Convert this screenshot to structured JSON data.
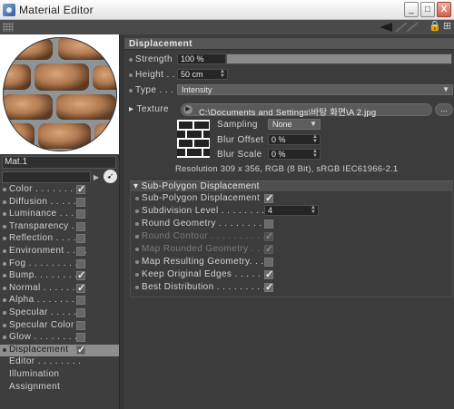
{
  "window": {
    "title": "Material Editor",
    "minimize_label": "_",
    "maximize_label": "□",
    "close_label": "X"
  },
  "left": {
    "material_name": "Mat.1",
    "channels": [
      {
        "label": "Color . . . . . . . . .",
        "checked": true
      },
      {
        "label": "Diffusion . . . . . .",
        "checked": false
      },
      {
        "label": "Luminance . . . . .",
        "checked": false
      },
      {
        "label": "Transparency . . .",
        "checked": false
      },
      {
        "label": "Reflection . . . . .",
        "checked": false
      },
      {
        "label": "Environment . . . .",
        "checked": false
      },
      {
        "label": "Fog . . . . . . . . . .",
        "checked": false
      },
      {
        "label": "Bump. . . . . . . . .",
        "checked": true
      },
      {
        "label": "Normal . . . . . . .",
        "checked": true
      },
      {
        "label": "Alpha . . . . . . . .",
        "checked": false
      },
      {
        "label": "Specular . . . . . .",
        "checked": false
      },
      {
        "label": "Specular Color",
        "checked": false
      },
      {
        "label": "Glow . . . . . . . . .",
        "checked": false
      },
      {
        "label": "Displacement",
        "checked": true
      }
    ],
    "extras": [
      "Editor . . . . . . . .",
      "Illumination",
      "Assignment"
    ]
  },
  "displacement": {
    "header": "Displacement",
    "strength_label": "Strength",
    "strength_value": "100 %",
    "strength_fraction": 1.0,
    "height_label": "Height . .",
    "height_value": "50 cm",
    "type_label": "Type . . .",
    "type_value": "Intensity",
    "texture_label": "Texture",
    "texture_path": "C:\\Documents and Settings\\바탕 화면\\A 2.jpg",
    "texture_more": "...",
    "sampling_label": "Sampling",
    "sampling_value": "None",
    "blur_offset_label": "Blur Offset",
    "blur_offset_value": "0 %",
    "blur_scale_label": "Blur Scale",
    "blur_scale_value": "0 %",
    "resolution": "Resolution 309 x 356, RGB (8 Bit), sRGB IEC61966-2.1"
  },
  "subpolygon": {
    "header": "Sub-Polygon Displacement",
    "rows": [
      {
        "label": "Sub-Polygon Displacement",
        "type": "check",
        "checked": true,
        "dim": false
      },
      {
        "label": "Subdivision Level . . . . . . . . .",
        "type": "number",
        "value": "4",
        "dim": false
      },
      {
        "label": "Round Geometry . . . . . . . . . .",
        "type": "check",
        "checked": false,
        "dim": false
      },
      {
        "label": "Round Contour . . . . . . . . . . .",
        "type": "check",
        "checked": true,
        "dim": true
      },
      {
        "label": "Map Rounded Geometry . . .",
        "type": "check",
        "checked": true,
        "dim": true
      },
      {
        "label": "Map Resulting Geometry. . .",
        "type": "check",
        "checked": false,
        "dim": false
      },
      {
        "label": "Keep Original Edges . . . . . .",
        "type": "check",
        "checked": true,
        "dim": false
      },
      {
        "label": "Best Distribution . . . . . . . . .",
        "type": "check",
        "checked": true,
        "dim": false
      }
    ]
  }
}
